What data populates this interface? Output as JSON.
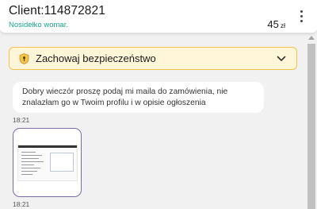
{
  "header": {
    "client_title": "Client:114872821",
    "subtitle": "Nosidełko womar.",
    "price_value": "45",
    "price_currency": "zł",
    "menu_icon": "kebab-menu-icon"
  },
  "safety_banner": {
    "label": "Zachowaj bezpieczeństwo",
    "icon": "shield-icon",
    "chevron": "chevron-down-icon",
    "accent_color": "#f1c44c",
    "background_color": "#fff6d9"
  },
  "messages": [
    {
      "type": "text",
      "text": "Dobry wieczór proszę podaj mi maila do zamówienia, nie znalazłam go w Twoim profilu i w opisie ogłoszenia",
      "time": "18:21"
    },
    {
      "type": "image",
      "time": "18:21"
    }
  ],
  "colors": {
    "subtitle": "#1aa58b",
    "image_border": "#7b69a8"
  }
}
